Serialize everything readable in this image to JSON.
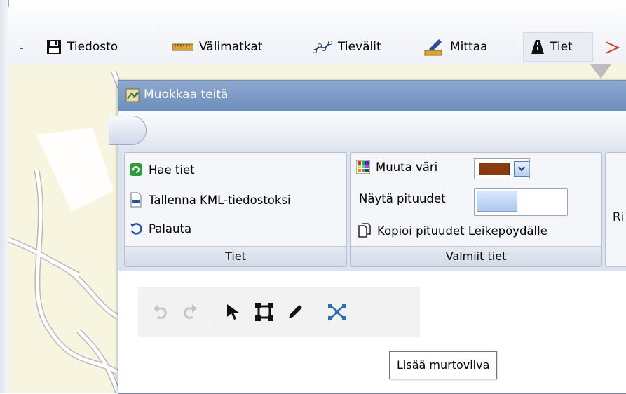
{
  "toolbar": {
    "items": [
      {
        "label": "Tiedosto",
        "icon": "save-icon"
      },
      {
        "label": "Välimatkat",
        "icon": "ruler-icon"
      },
      {
        "label": "Tievälit",
        "icon": "route-line-icon"
      },
      {
        "label": "Mittaa",
        "icon": "measure-pencil-icon"
      },
      {
        "label": "Tiet",
        "icon": "road-icon"
      }
    ]
  },
  "dialog": {
    "title": "Muokkaa teitä",
    "ribbon": {
      "groups": [
        {
          "label": "Tiet",
          "buttons": [
            {
              "label": "Hae tiet",
              "icon": "refresh-green-icon"
            },
            {
              "label": "Tallenna KML-tiedostoksi",
              "icon": "kml-file-icon"
            },
            {
              "label": "Palauta",
              "icon": "undo-blue-icon"
            }
          ]
        },
        {
          "label": "Valmiit tiet",
          "color_label": "Muuta väri",
          "color_value": "#8b3a10",
          "lengths_label": "Näytä pituudet",
          "copy_label": "Kopioi pituudet Leikepöydälle"
        }
      ],
      "partial_text": "Ri"
    },
    "draw_tools": {
      "tooltip": "Lisää murtoviiva"
    }
  },
  "colors": {
    "accent": "#6b8dbd",
    "map_bg": "#f7f4df"
  }
}
